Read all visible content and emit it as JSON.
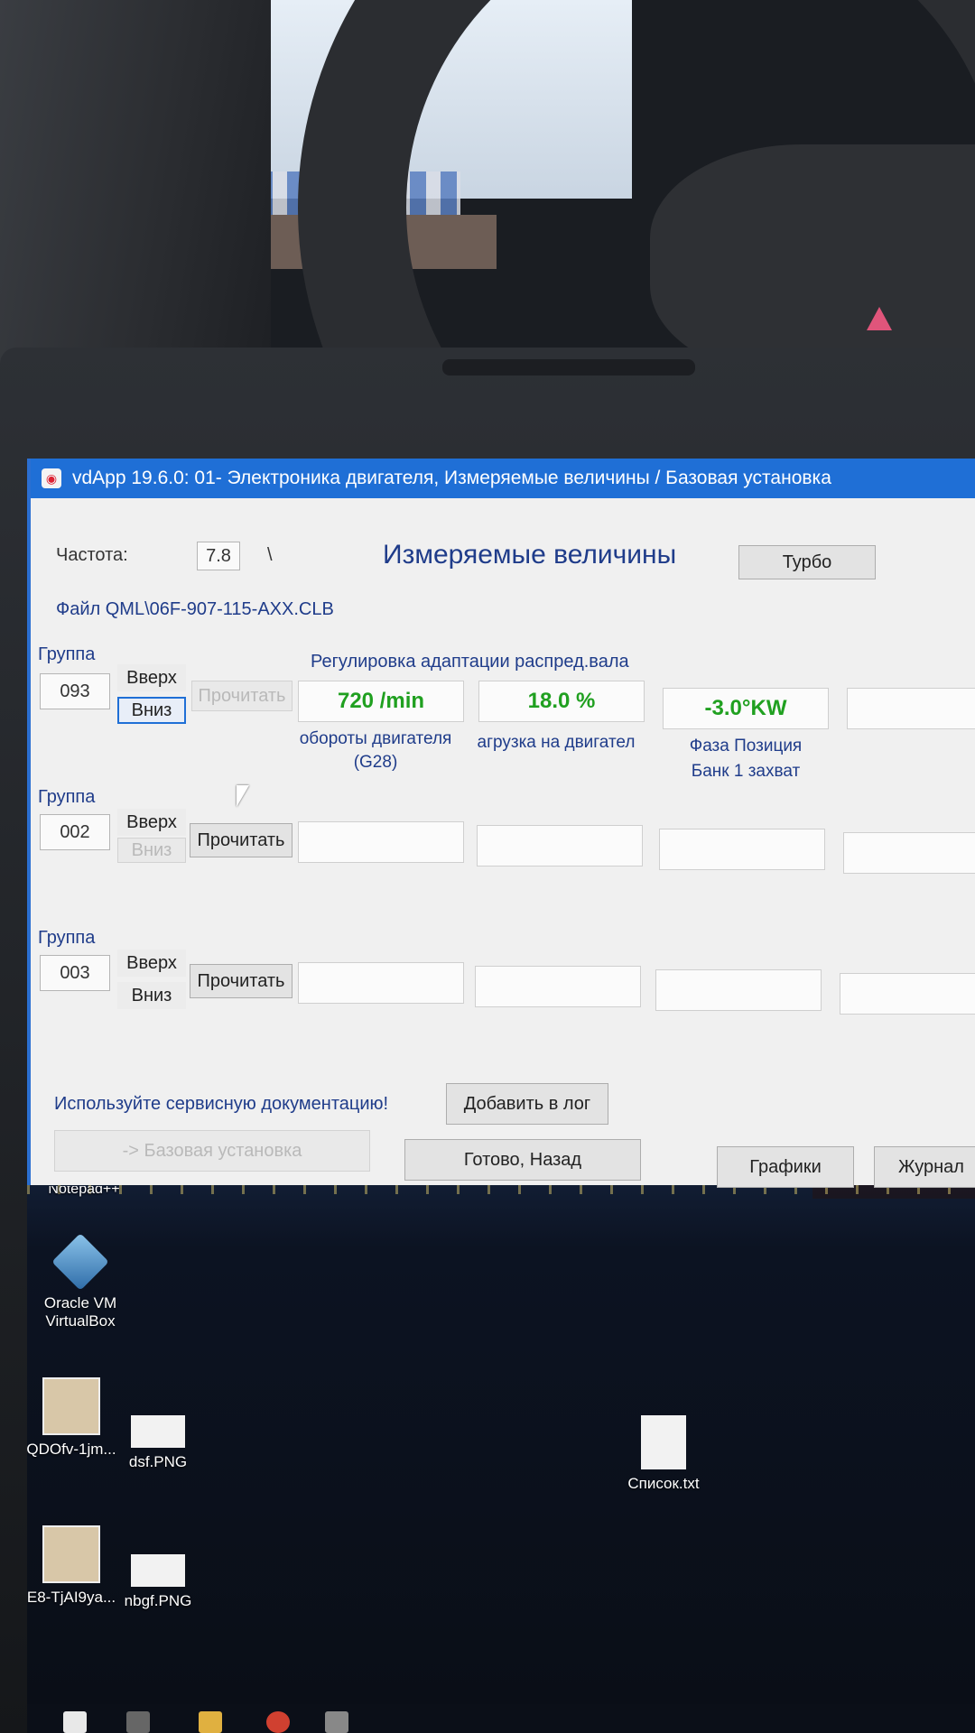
{
  "window": {
    "title": "vdApp 19.6.0: 01- Электроника двигателя,  Измеряемые величины / Базовая установка"
  },
  "header": {
    "freq_label": "Частота:",
    "freq_value": "7.8",
    "freq_sep": "\\",
    "file_label": "Файл QML\\06F-907-115-AXX.CLB",
    "page_title": "Измеряемые величины",
    "turbo_label": "Турбо"
  },
  "groups": [
    {
      "group_label": "Группа",
      "number": "093",
      "up_label": "Вверх",
      "down_label": "Вниз",
      "read_label": "Прочитать",
      "description": "Регулировка адаптации распред.вала",
      "values": [
        "720 /min",
        "18.0 %",
        "-3.0°KW",
        ""
      ],
      "captions": [
        [
          "обороты двигателя",
          "(G28)"
        ],
        [
          "агрузка на двигател",
          ""
        ],
        [
          "Фаза Позиция",
          "Банк 1 захват"
        ],
        [
          "",
          ""
        ]
      ]
    },
    {
      "group_label": "Группа",
      "number": "002",
      "up_label": "Вверх",
      "down_label": "Вниз",
      "read_label": "Прочитать",
      "values": [
        "",
        "",
        "",
        ""
      ]
    },
    {
      "group_label": "Группа",
      "number": "003",
      "up_label": "Вверх",
      "down_label": "Вниз",
      "read_label": "Прочитать",
      "values": [
        "",
        "",
        "",
        ""
      ]
    }
  ],
  "footer": {
    "notice": "Используйте сервисную документацию!",
    "add_log_label": "Добавить в лог",
    "basic_settings_label": "-> Базовая установка",
    "done_back_label": "Готово, Назад",
    "graphs_label": "Графики",
    "journal_label": "Журнал"
  },
  "desktop": {
    "partial_label": "Notepad++",
    "icons": [
      {
        "label": "Oracle VM\nVirtualBox",
        "icon": "virtualbox-icon"
      },
      {
        "label": "QDOfv-1jm...",
        "icon": "image-file-icon"
      },
      {
        "label": "dsf.PNG",
        "icon": "image-file-icon"
      },
      {
        "label": "Список.txt",
        "icon": "text-file-icon"
      },
      {
        "label": "E8-TjAI9ya...",
        "icon": "image-file-icon"
      },
      {
        "label": "nbgf.PNG",
        "icon": "image-file-icon"
      }
    ]
  },
  "colors": {
    "titlebar": "#1f6fd6",
    "value_text": "#20a020",
    "label_text": "#1f3c8a"
  }
}
